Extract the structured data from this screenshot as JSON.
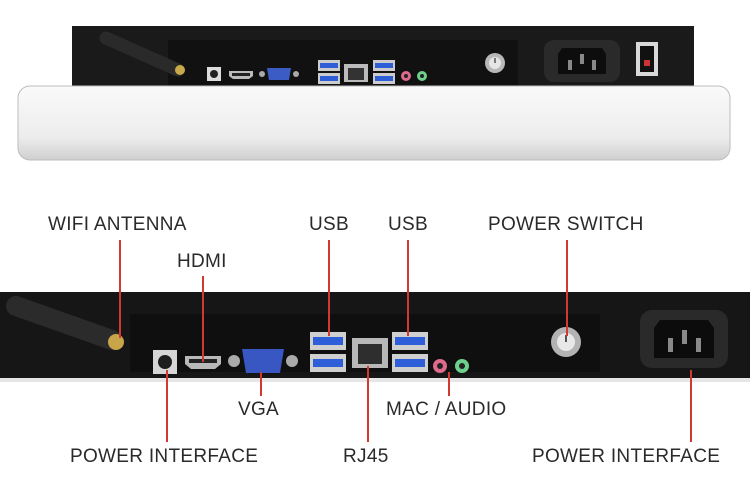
{
  "labels": {
    "wifi_antenna": "WIFI ANTENNA",
    "hdmi": "HDMI",
    "usb_left": "USB",
    "usb_right": "USB",
    "power_switch": "POWER SWITCH",
    "vga": "VGA",
    "mac_audio": "MAC / AUDIO",
    "power_interface_left": "POWER INTERFACE",
    "rj45": "RJ45",
    "power_interface_right": "POWER INTERFACE"
  },
  "colors": {
    "leader_line": "#d23a2f",
    "chassis": "#1b1b1b",
    "bezel": "#efefef"
  },
  "icons": [
    "wifi-antenna-icon",
    "dc-jack-icon",
    "hdmi-port-icon",
    "vga-port-icon",
    "usb-port-icon",
    "rj45-port-icon",
    "audio-jack-icon",
    "power-button-icon",
    "iec-power-socket-icon",
    "rocker-switch-icon"
  ]
}
